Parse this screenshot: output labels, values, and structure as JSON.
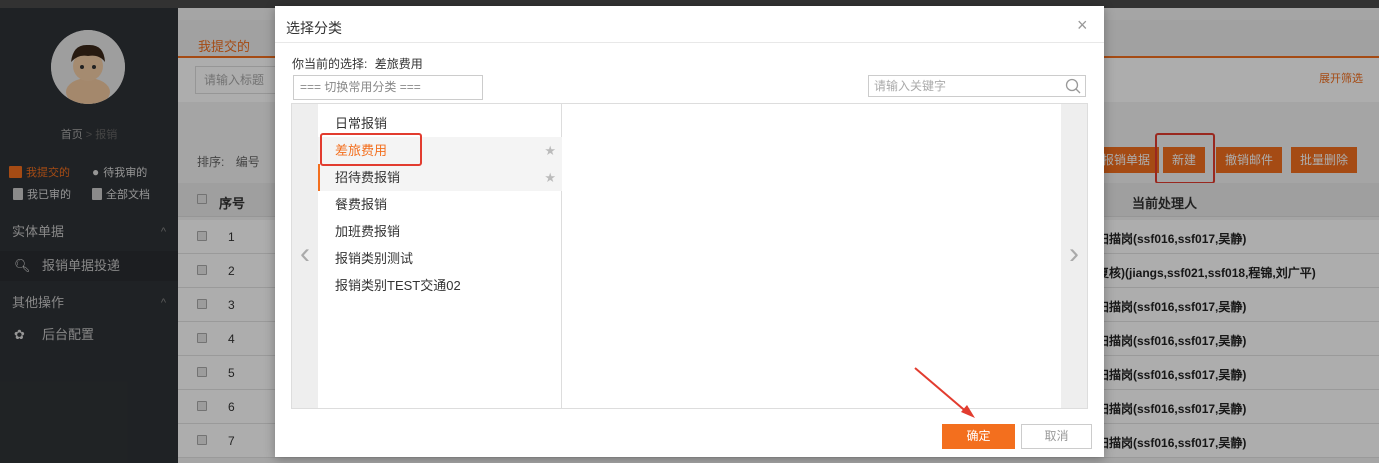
{
  "sidebar": {
    "breadcrumb_home": "首页",
    "breadcrumb_sep": ">",
    "breadcrumb_current": "报销",
    "quick_links": [
      "我提交的",
      "待我审的",
      "我已审的",
      "全部文档"
    ],
    "sections": [
      {
        "label": "实体单据",
        "items": [
          "报销单据投递"
        ]
      },
      {
        "label": "其他操作",
        "items": [
          "后台配置"
        ]
      }
    ]
  },
  "main": {
    "tab_title": "我提交的",
    "title_placeholder": "请输入标题",
    "expand_filter": "展开筛选",
    "sort_label": "排序:",
    "sort_field": "编号",
    "buttons": [
      "报销单据",
      "新建",
      "撤销邮件",
      "批量删除"
    ],
    "table_headers": {
      "seq": "序号",
      "handler": "当前处理人"
    },
    "rows": [
      {
        "num": "1",
        "handler": "扫描岗(ssf016,ssf017,吴静)"
      },
      {
        "num": "2",
        "handler": "复核)(jiangs,ssf021,ssf018,程锦,刘广平)"
      },
      {
        "num": "3",
        "handler": "扫描岗(ssf016,ssf017,吴静)"
      },
      {
        "num": "4",
        "handler": "扫描岗(ssf016,ssf017,吴静)"
      },
      {
        "num": "5",
        "handler": "扫描岗(ssf016,ssf017,吴静)"
      },
      {
        "num": "6",
        "handler": "扫描岗(ssf016,ssf017,吴静)"
      },
      {
        "num": "7",
        "handler": "扫描岗(ssf016,ssf017,吴静)"
      }
    ]
  },
  "dialog": {
    "title": "选择分类",
    "close": "×",
    "current_label": "你当前的选择:",
    "current_value": "差旅费用",
    "common_category_placeholder": "=== 切换常用分类 ===",
    "keyword_placeholder": "请输入关键字",
    "categories": [
      "日常报销",
      "差旅费用",
      "招待费报销",
      "餐费报销",
      "加班费报销",
      "报销类别测试",
      "报销类别TEST交通02"
    ],
    "ok": "确定",
    "cancel": "取消"
  },
  "colors": {
    "accent": "#f36f1e",
    "highlight": "#e23c2f",
    "sidebar": "#2f3337"
  }
}
